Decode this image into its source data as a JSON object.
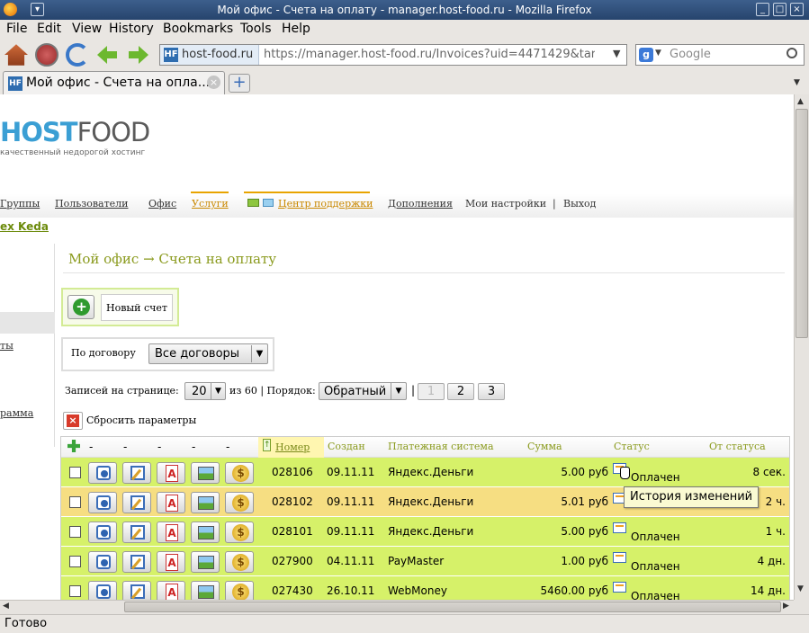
{
  "window": {
    "title": "Мой офис - Счета на оплату - manager.host-food.ru - Mozilla Firefox"
  },
  "menu": [
    "File",
    "Edit",
    "View",
    "History",
    "Bookmarks",
    "Tools",
    "Help"
  ],
  "url": {
    "host": "host-food.ru",
    "address": "https://manager.host-food.ru/Invoices?uid=4471429&targ"
  },
  "search": {
    "placeholder": "Google"
  },
  "tab": {
    "title": "Мой офис - Счета на опла..."
  },
  "logo": {
    "host": "HOST",
    "food": "FOOD",
    "tagline": "качественный недорогой хостинг"
  },
  "topnav": {
    "groups": "Группы",
    "users": "Пользователи",
    "office": "Офис",
    "services": "Услуги",
    "support": "Центр поддержки",
    "extras": "Дополнения",
    "settings": "Мои настройки",
    "sep": "|",
    "logout": "Выход"
  },
  "user": "ex Keda",
  "sidebar": {
    "item1": "ты",
    "item2": "рамма"
  },
  "breadcrumb": "Мой офис → Счета на оплату",
  "new_invoice": "Новый счет",
  "filter": {
    "label": "По договору",
    "value": "Все договоры"
  },
  "paging": {
    "per_page_label": "Записей на странице:",
    "per_page": "20",
    "of": "из 60 | Порядок:",
    "order": "Обратный",
    "sep": "|",
    "pages": [
      "1",
      "2",
      "3"
    ]
  },
  "reset": "Сбросить параметры",
  "table": {
    "dashes": [
      "-",
      "-",
      "-",
      "-",
      "-"
    ],
    "headers": {
      "number": "Номер",
      "created": "Создан",
      "system": "Платежная система",
      "sum": "Сумма",
      "status": "Статус",
      "from_status": "От статуса"
    },
    "rows": [
      {
        "number": "028106",
        "created": "09.11.11",
        "system": "Яндекс.Деньги",
        "sum": "5.00 руб",
        "status": "Оплачен",
        "ago": "8 сек.",
        "bg": "#d6f169"
      },
      {
        "number": "028102",
        "created": "09.11.11",
        "system": "Яндекс.Деньги",
        "sum": "5.01 руб",
        "status": "",
        "ago": "2 ч.",
        "bg": "#f6de82"
      },
      {
        "number": "028101",
        "created": "09.11.11",
        "system": "Яндекс.Деньги",
        "sum": "5.00 руб",
        "status": "Оплачен",
        "ago": "1 ч.",
        "bg": "#d6f169"
      },
      {
        "number": "027900",
        "created": "04.11.11",
        "system": "PayMaster",
        "sum": "1.00 руб",
        "status": "Оплачен",
        "ago": "4 дн.",
        "bg": "#d6f169"
      },
      {
        "number": "027430",
        "created": "26.10.11",
        "system": "WebMoney",
        "sum": "5460.00 руб",
        "status": "Оплачен",
        "ago": "14 дн.",
        "bg": "#d6f169"
      }
    ]
  },
  "tooltip": "История изменений",
  "status": "Готово",
  "colors": {
    "accent": "#8a9a1d",
    "row_paid": "#d6f169",
    "row_highlight": "#f6de82",
    "logo_blue": "#3b9fd4"
  }
}
